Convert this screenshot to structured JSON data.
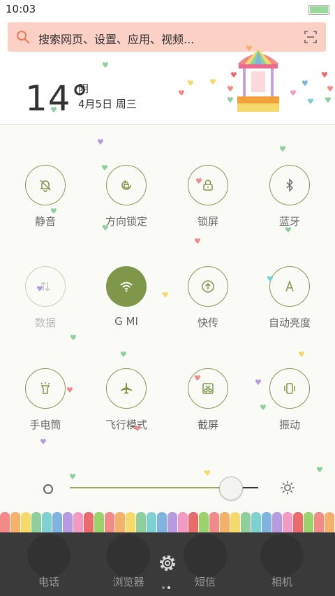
{
  "status_bar": {
    "time": "10:03"
  },
  "search": {
    "placeholder": "搜索网页、设置、应用、视频..."
  },
  "weather": {
    "temperature": "14°",
    "condition": "阴",
    "date": "4月5日 周三"
  },
  "quick_settings": [
    {
      "label": "静音",
      "icon": "bell-icon",
      "active": false
    },
    {
      "label": "方向锁定",
      "icon": "rotation-lock-icon",
      "active": false
    },
    {
      "label": "锁屏",
      "icon": "lock-icon",
      "active": false
    },
    {
      "label": "蓝牙",
      "icon": "bluetooth-icon",
      "active": false
    },
    {
      "label": "数据",
      "icon": "mobile-data-icon",
      "active": false,
      "disabled": true
    },
    {
      "label": "G MI",
      "icon": "wifi-icon",
      "active": true
    },
    {
      "label": "快传",
      "icon": "upload-icon",
      "active": false
    },
    {
      "label": "自动亮度",
      "icon": "auto-brightness-icon",
      "active": false
    },
    {
      "label": "手电筒",
      "icon": "flashlight-icon",
      "active": false
    },
    {
      "label": "飞行模式",
      "icon": "airplane-icon",
      "active": false
    },
    {
      "label": "截屏",
      "icon": "screenshot-icon",
      "active": false
    },
    {
      "label": "振动",
      "icon": "vibrate-icon",
      "active": false
    }
  ],
  "brightness": {
    "level": 0.85
  },
  "dock": [
    {
      "label": "电话",
      "icon": "phone-icon"
    },
    {
      "label": "浏览器",
      "icon": "browser-icon"
    },
    {
      "label": "短信",
      "icon": "message-icon"
    },
    {
      "label": "相机",
      "icon": "camera-icon"
    }
  ],
  "colors": {
    "accent": "#7f9748",
    "search_bg": "#fbd0c5",
    "dock_bg": "#3a3a3a"
  }
}
